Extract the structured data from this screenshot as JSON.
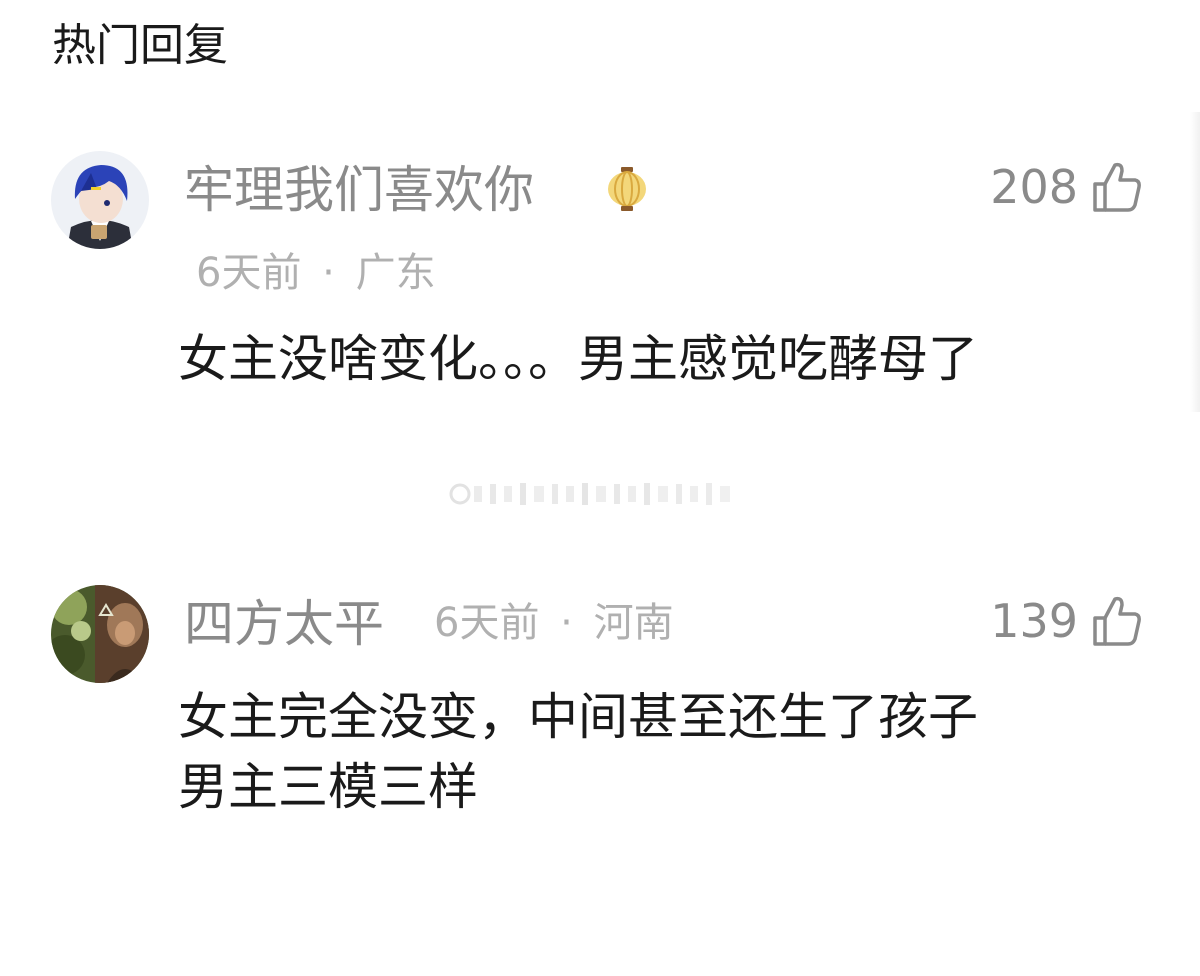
{
  "section": {
    "title": "热门回复"
  },
  "comments": [
    {
      "username": "牢理我们喜欢你",
      "badge_icon": "lantern-badge-icon",
      "time": "6天前",
      "separator": "·",
      "location": "广东",
      "likes": "208",
      "text": "女主没啥变化。。。男主感觉吃酵母了"
    },
    {
      "username": "四方太平",
      "time": "6天前",
      "separator": "·",
      "location": "河南",
      "likes": "139",
      "text": "女主完全没变，中间甚至还生了孩子\n男主三模三样"
    }
  ],
  "icons": {
    "like": "thumbs-up-icon"
  },
  "colors": {
    "text_primary": "#1a1a1a",
    "text_secondary": "#8a8a8a",
    "text_meta": "#b0b0b0"
  }
}
